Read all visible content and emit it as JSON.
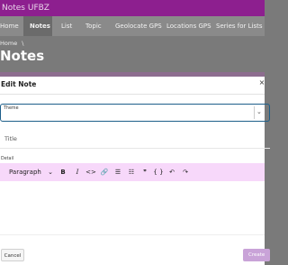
{
  "app": {
    "title": "Notes UFBZ"
  },
  "nav": {
    "items": [
      {
        "label": "Home"
      },
      {
        "label": "Notes"
      },
      {
        "label": "List"
      },
      {
        "label": "Topic"
      },
      {
        "label": "Geolocate GPS"
      },
      {
        "label": "Locations GPS"
      },
      {
        "label": "Series for Lists"
      }
    ],
    "active": "Notes"
  },
  "breadcrumb": {
    "home": "Home",
    "separator": "\\"
  },
  "page": {
    "title": "Notes"
  },
  "modal": {
    "title": "Edit Note",
    "close_glyph": "×",
    "theme": {
      "label": "Theme",
      "chevron": "⌄"
    },
    "title_field": {
      "placeholder": "Title"
    },
    "detail": {
      "label": "Detail",
      "toolbar": {
        "block_format": "Paragraph",
        "block_chevron": "⌄",
        "bold": "B",
        "italic": "I",
        "code": "<>",
        "link": "🔗",
        "bulleted_list": "☰",
        "numbered_list": "☷",
        "blockquote": "❞",
        "code_block": "{ }",
        "undo": "↶",
        "redo": "↷"
      }
    },
    "cancel_label": "Cancel",
    "create_label": "Create"
  },
  "colors": {
    "app_bar": "#8d1f8f",
    "toolbar": "#f7d8fa",
    "create_button": "#c9a3d8",
    "focus_border": "#1d5f8a"
  }
}
